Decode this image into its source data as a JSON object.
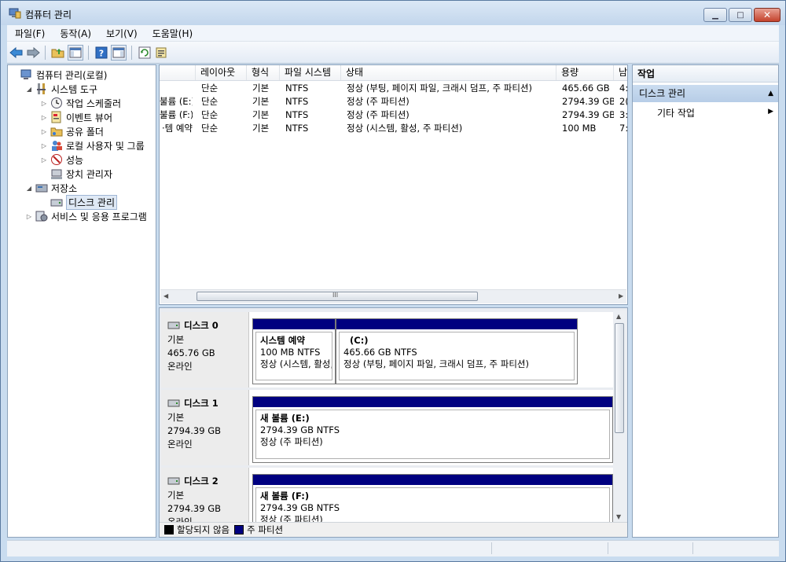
{
  "window": {
    "title": "컴퓨터 관리"
  },
  "menu": [
    "파일(F)",
    "동작(A)",
    "보기(V)",
    "도움말(H)"
  ],
  "toolbar": [
    "back-icon",
    "forward-icon",
    "folder-up-icon",
    "console-tree-icon",
    "help-icon",
    "action-pane-icon",
    "refresh-icon",
    "properties-icon"
  ],
  "tree": [
    {
      "label": "컴퓨터 관리(로컬)",
      "level": 0,
      "exp": "",
      "icon": "computer-icon"
    },
    {
      "label": "시스템 도구",
      "level": 1,
      "exp": "◢",
      "icon": "tools-icon"
    },
    {
      "label": "작업 스케줄러",
      "level": 2,
      "exp": "▷",
      "icon": "clock-icon"
    },
    {
      "label": "이벤트 뷰어",
      "level": 2,
      "exp": "▷",
      "icon": "event-viewer-icon"
    },
    {
      "label": "공유 폴더",
      "level": 2,
      "exp": "▷",
      "icon": "shared-folder-icon"
    },
    {
      "label": "로컬 사용자 및 그룹",
      "level": 2,
      "exp": "▷",
      "icon": "users-icon"
    },
    {
      "label": "성능",
      "level": 2,
      "exp": "▷",
      "icon": "performance-icon"
    },
    {
      "label": "장치 관리자",
      "level": 2,
      "exp": "",
      "icon": "device-manager-icon"
    },
    {
      "label": "저장소",
      "level": 1,
      "exp": "◢",
      "icon": "storage-icon"
    },
    {
      "label": "디스크 관리",
      "level": 2,
      "exp": "",
      "icon": "disk-management-icon",
      "selected": true
    },
    {
      "label": "서비스 및 응용 프로그램",
      "level": 1,
      "exp": "▷",
      "icon": "services-icon"
    }
  ],
  "volumes": {
    "columns": [
      "",
      "레이아웃",
      "형식",
      "파일 시스템",
      "상태",
      "용량",
      "남"
    ],
    "rows": [
      [
        "",
        "단순",
        "기본",
        "NTFS",
        "정상 (부팅, 페이지 파일, 크래시 덤프, 주 파티션)",
        "465.66 GB",
        "4:"
      ],
      [
        "불륨 (E:)",
        "단순",
        "기본",
        "NTFS",
        "정상 (주 파티션)",
        "2794.39 GB",
        "2("
      ],
      [
        "불륨 (F:)",
        "단순",
        "기본",
        "NTFS",
        "정상 (주 파티션)",
        "2794.39 GB",
        "3:"
      ],
      [
        "·템 예약",
        "단순",
        "기본",
        "NTFS",
        "정상 (시스템, 활성, 주 파티션)",
        "100 MB",
        "7:"
      ]
    ],
    "scroll_mark": "III"
  },
  "disks": [
    {
      "name": "디스크 0",
      "type": "기본",
      "size": "465.76 GB",
      "status": "온라인",
      "partitions": [
        {
          "title": "시스템 예약",
          "size": "100 MB NTFS",
          "status": "정상 (시스템, 활성, 주 파티션)"
        },
        {
          "title": "(C:)",
          "size": "465.66 GB NTFS",
          "status": "정상 (부팅, 페이지 파일, 크래시 덤프, 주 파티션)"
        }
      ]
    },
    {
      "name": "디스크 1",
      "type": "기본",
      "size": "2794.39 GB",
      "status": "온라인",
      "partitions": [
        {
          "title": "새 볼륨  (E:)",
          "size": "2794.39 GB NTFS",
          "status": "정상 (주 파티션)"
        }
      ]
    },
    {
      "name": "디스크 2",
      "type": "기본",
      "size": "2794.39 GB",
      "status": "온라인",
      "partitions": [
        {
          "title": "새 볼륨  (F:)",
          "size": "2794.39 GB NTFS",
          "status": "정상 (주 파티션)"
        }
      ]
    }
  ],
  "legend": [
    {
      "label": "할당되지 않음",
      "color": "#000000"
    },
    {
      "label": "주 파티션",
      "color": "#000080"
    }
  ],
  "actions": {
    "header": "작업",
    "section": "디스크 관리",
    "item": "기타 작업"
  },
  "colors": {
    "partition_bar": "#000080",
    "selection": "#dfe9f5"
  }
}
